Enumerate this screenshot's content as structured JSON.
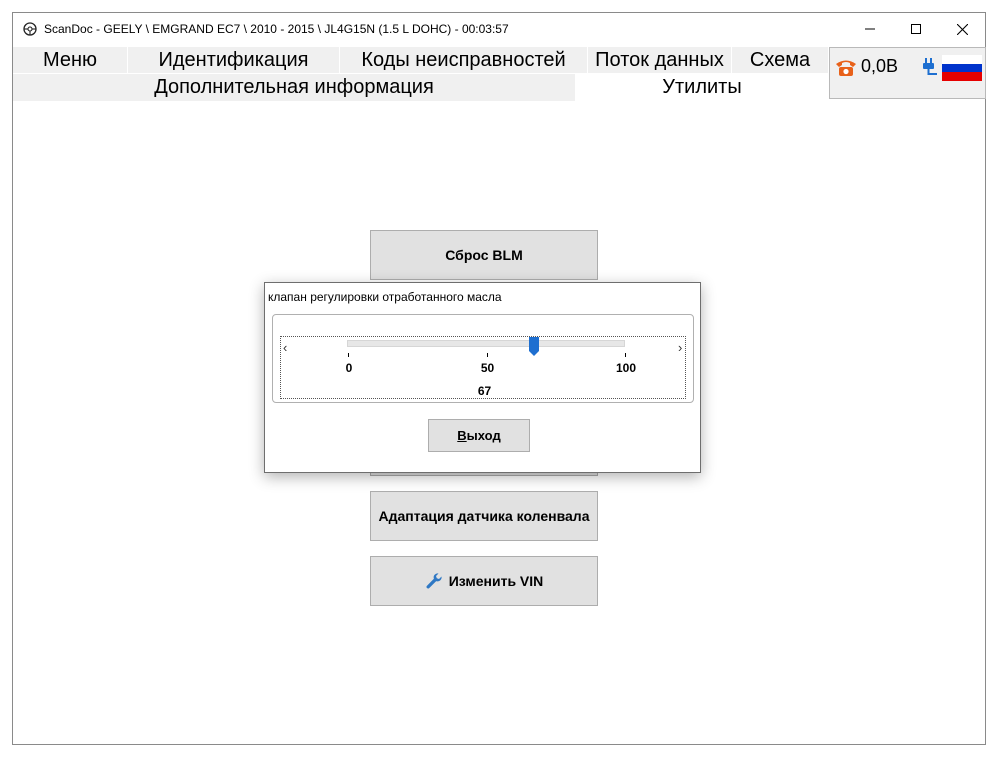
{
  "window": {
    "title": "ScanDoc - GEELY \\ EMGRAND EC7 \\ 2010 - 2015 \\ JL4G15N (1.5 L DOHC) - 00:03:57"
  },
  "tabs_row1": [
    {
      "label": "Меню"
    },
    {
      "label": "Идентификация"
    },
    {
      "label": "Коды неисправностей"
    },
    {
      "label": "Поток данных"
    },
    {
      "label": "Схема"
    }
  ],
  "tabs_row2": [
    {
      "label": "Дополнительная информация",
      "active": false
    },
    {
      "label": "Утилиты",
      "active": true
    }
  ],
  "status": {
    "voltage": "0,0В",
    "phone_icon": "phone-icon",
    "plug_icon": "plug-icon",
    "flag_colors": [
      "#ffffff",
      "#0033cc",
      "#e60000"
    ]
  },
  "utilities": [
    {
      "label": "Сброс BLM",
      "icon": ""
    },
    {
      "label": "Адаптация датчика коленвала",
      "icon": ""
    },
    {
      "label": "Изменить VIN",
      "icon": "wrench-icon"
    }
  ],
  "dialog": {
    "title": "клапан регулировки отработанного масла",
    "slider": {
      "min": 0,
      "max": 100,
      "value": 67,
      "ticks": [
        "0",
        "50",
        "100"
      ],
      "value_label": "67"
    },
    "exit_label_underlined": "В",
    "exit_label_rest": "ыход"
  },
  "colors": {
    "accent": "#1e6fd0",
    "phone": "#e8611a"
  }
}
